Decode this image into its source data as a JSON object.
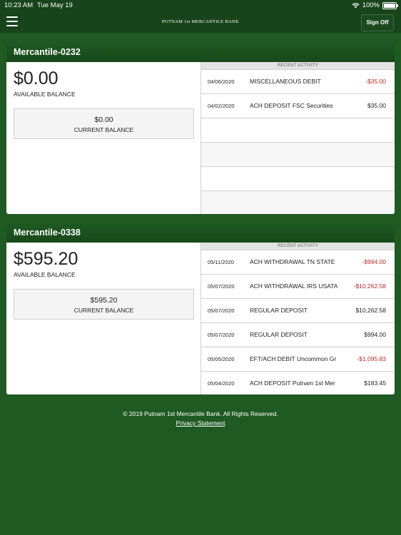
{
  "status": {
    "time": "10:23 AM",
    "date": "Tue May 19",
    "battery": "100%"
  },
  "nav": {
    "title": "PUTNAM 1st MERCANTILE BANK",
    "sign_off": "Sign Off"
  },
  "accounts": [
    {
      "name": "Mercantile-0232",
      "available_balance": "$0.00",
      "available_label": "AVAILABLE BALANCE",
      "current_balance": "$0.00",
      "current_label": "CURRENT BALANCE",
      "activity_header": "RECENT ACTIVITY",
      "activity": [
        {
          "date": "04/06/2020",
          "desc": "MISCELLANEOUS DEBIT",
          "amount": "-$35.00",
          "negative": true
        },
        {
          "date": "04/02/2020",
          "desc": "ACH DEPOSIT FSC Securities",
          "amount": "$35.00",
          "negative": false
        },
        {
          "date": "",
          "desc": "",
          "amount": "",
          "negative": false
        },
        {
          "date": "",
          "desc": "",
          "amount": "",
          "negative": false
        },
        {
          "date": "",
          "desc": "",
          "amount": "",
          "negative": false
        },
        {
          "date": "",
          "desc": "",
          "amount": "",
          "negative": false
        }
      ]
    },
    {
      "name": "Mercantile-0338",
      "available_balance": "$595.20",
      "available_label": "AVAILABLE BALANCE",
      "current_balance": "$595.20",
      "current_label": "CURRENT BALANCE",
      "activity_header": "RECENT ACTIVITY",
      "activity": [
        {
          "date": "05/11/2020",
          "desc": "ACH WITHDRAWAL TN STATE",
          "amount": "-$994.00",
          "negative": true
        },
        {
          "date": "05/07/2020",
          "desc": "ACH WITHDRAWAL IRS USATA",
          "amount": "-$10,262.58",
          "negative": true
        },
        {
          "date": "05/07/2020",
          "desc": "REGULAR DEPOSIT",
          "amount": "$10,262.58",
          "negative": false
        },
        {
          "date": "05/07/2020",
          "desc": "REGULAR DEPOSIT",
          "amount": "$994.00",
          "negative": false
        },
        {
          "date": "05/05/2020",
          "desc": "EFT/ACH DEBIT Uncommon Gr",
          "amount": "-$1,095.83",
          "negative": true
        },
        {
          "date": "05/04/2020",
          "desc": "ACH DEPOSIT Putnam 1st Mer",
          "amount": "$183.45",
          "negative": false
        }
      ]
    }
  ],
  "footer": {
    "copyright": "© 2019 Putnam 1st Mercantile Bank. All Rights Reserved.",
    "privacy": "Privacy Statement"
  },
  "colors": {
    "background": "#1f5a22",
    "header": "#18441b",
    "negative": "#b52b27"
  },
  "icons": [
    "menu-icon",
    "wifi-icon",
    "battery-icon"
  ]
}
